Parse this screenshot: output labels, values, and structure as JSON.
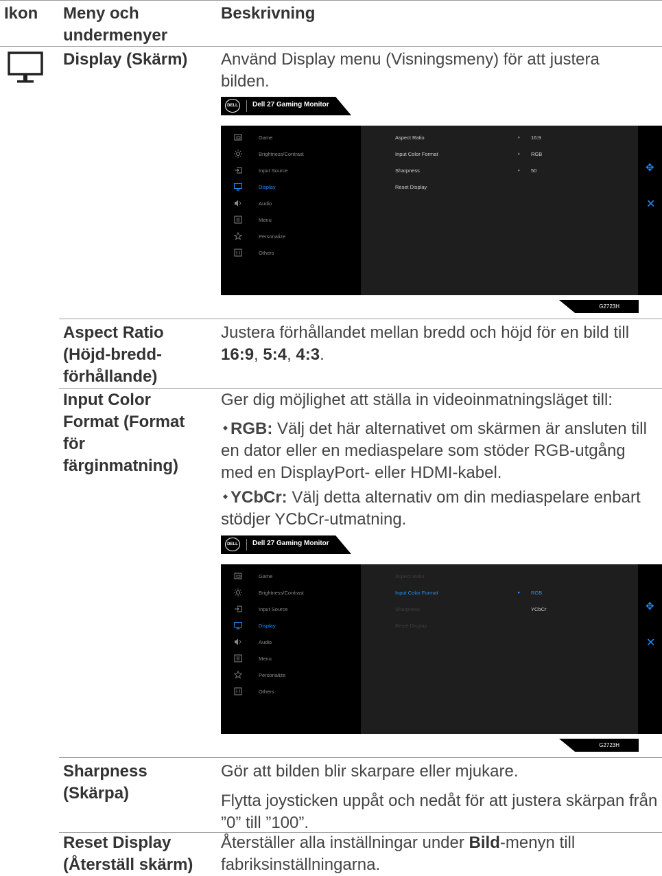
{
  "table": {
    "headers": {
      "icon": "Ikon",
      "menu": "Meny och undermenyer",
      "desc": "Beskrivning"
    },
    "display": {
      "name": "Display (Skärm)",
      "desc": "Använd Display menu (Visningsmeny) för att justera bilden."
    },
    "aspect": {
      "name": "Aspect Ratio (Höjd-bredd-förhållande)",
      "desc_prefix": "Justera förhållandet mellan bredd och höjd för en bild till ",
      "opt1": "16:9",
      "sep1": ", ",
      "opt2": "5:4",
      "sep2": ", ",
      "opt3": "4:3",
      "end": "."
    },
    "input_color": {
      "name": "Input Color Format (Format för färginmatning)",
      "desc": "Ger dig möjlighet att ställa in videoinmatningsläget till:",
      "bullet1_label": "RGB:",
      "bullet1_text": " Välj det här alternativet om skärmen är ansluten till en dator eller en mediaspelare som stöder RGB-utgång med en DisplayPort- eller HDMI-kabel.",
      "bullet2_label": "YCbCr:",
      "bullet2_text": " Välj detta alternativ om din mediaspelare enbart stödjer YCbCr-utmatning."
    },
    "sharpness": {
      "name": "Sharpness (Skärpa)",
      "desc1": "Gör att bilden blir skarpare eller mjukare.",
      "desc2": "Flytta joysticken uppåt och nedåt för att justera skärpan från ”0” till ”100”."
    },
    "reset": {
      "name": "Reset Display (Återställ skärm)",
      "desc_prefix": "Återställer alla inställningar under ",
      "desc_bold": "Bild",
      "desc_suffix": "-menyn till fabriksinställningarna."
    }
  },
  "osd": {
    "logo": "DELL",
    "title": "Dell 27 Gaming Monitor",
    "model": "G2723H",
    "menu_items": [
      "Game",
      "Brightness/Contrast",
      "Input Source",
      "Display",
      "Audio",
      "Menu",
      "Personalize",
      "Others"
    ],
    "display_rows": [
      "Aspect Ratio",
      "Input Color Format",
      "Sharpness",
      "Reset Display"
    ],
    "display_values": [
      "16:9",
      "RGB",
      "50"
    ],
    "color_options": [
      "RGB",
      "YCbCr"
    ]
  },
  "colors": {
    "osd_accent": "#1e90ff",
    "osd_bg": "#000000",
    "osd_panel": "#1e1e1e"
  }
}
